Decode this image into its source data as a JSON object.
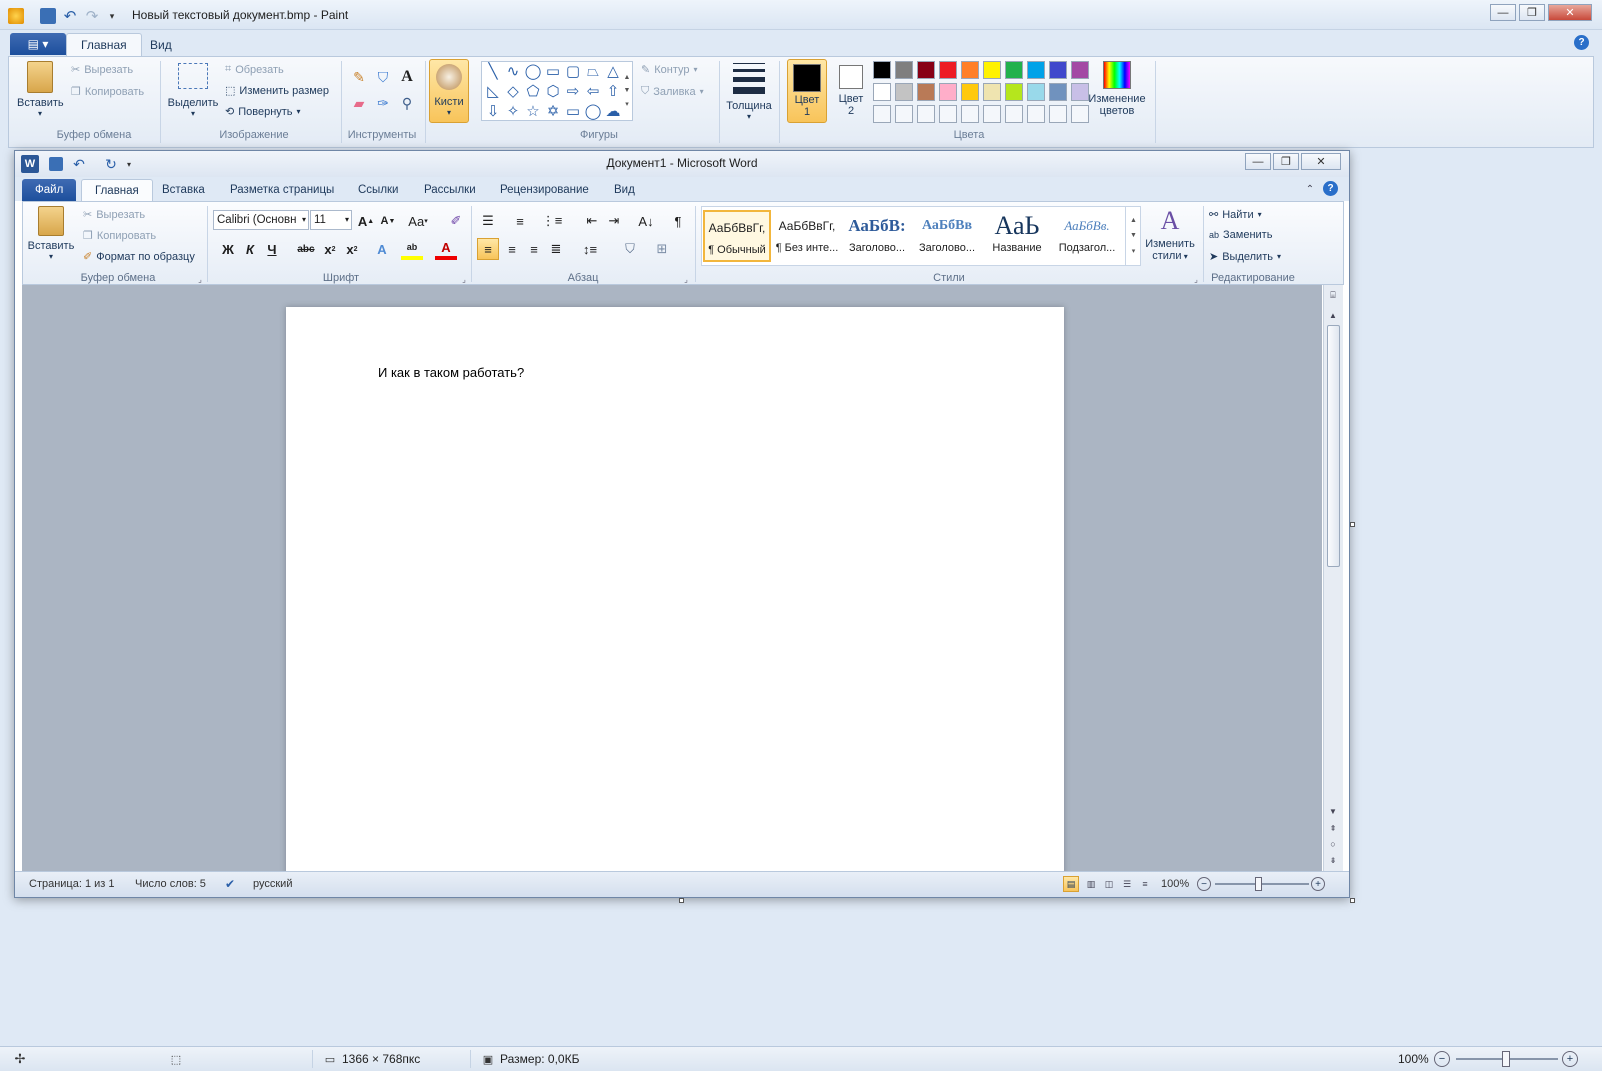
{
  "paint": {
    "title": "Новый текстовый документ.bmp - Paint",
    "tabs": [
      "Главная",
      "Вид"
    ],
    "clipboard": {
      "paste": "Вставить",
      "cut": "Вырезать",
      "copy": "Копировать",
      "group": "Буфер обмена"
    },
    "image": {
      "select": "Выделить",
      "crop": "Обрезать",
      "resize": "Изменить размер",
      "rotate": "Повернуть",
      "group": "Изображение"
    },
    "tools": {
      "group": "Инструменты"
    },
    "brushes": "Кисти",
    "shapes": {
      "outline": "Контур",
      "fill": "Заливка",
      "group": "Фигуры"
    },
    "size": "Толщина",
    "color1": {
      "label": "Цвет",
      "num": "1"
    },
    "color2": {
      "label": "Цвет",
      "num": "2"
    },
    "edit_colors": {
      "line1": "Изменение",
      "line2": "цветов"
    },
    "colors_group": "Цвета",
    "palette_row1": [
      "#000000",
      "#7f7f7f",
      "#880015",
      "#ed1c24",
      "#ff7f27",
      "#fff200",
      "#22b14c",
      "#00a2e8",
      "#3f48cc",
      "#a349a4"
    ],
    "palette_row2": [
      "#ffffff",
      "#c3c3c3",
      "#b97a57",
      "#ffaec9",
      "#ffc90e",
      "#efe4b0",
      "#b5e61d",
      "#99d9ea",
      "#7092be",
      "#c8bfe7"
    ],
    "status": {
      "dimensions": "1366 × 768пкс",
      "size": "Размер: 0,0КБ",
      "zoom": "100%"
    }
  },
  "word": {
    "title": "Документ1  -  Microsoft Word",
    "tabs": [
      "Файл",
      "Главная",
      "Вставка",
      "Разметка страницы",
      "Ссылки",
      "Рассылки",
      "Рецензирование",
      "Вид"
    ],
    "clipboard": {
      "paste": "Вставить",
      "cut": "Вырезать",
      "copy": "Копировать",
      "format_painter": "Формат по образцу",
      "group": "Буфер обмена"
    },
    "font": {
      "name": "Calibri (Основн",
      "size": "11",
      "group": "Шрифт"
    },
    "paragraph_group": "Абзац",
    "styles": [
      {
        "sample": "АаБбВвГг,",
        "name": "¶ Обычный"
      },
      {
        "sample": "АаБбВвГг,",
        "name": "¶ Без инте..."
      },
      {
        "sample": "АаБбВ:",
        "name": "Заголово..."
      },
      {
        "sample": "АаБбВв",
        "name": "Заголово..."
      },
      {
        "sample": "АаЬ",
        "name": "Название"
      },
      {
        "sample": "АаБбВв.",
        "name": "Подзагол..."
      }
    ],
    "change_styles": {
      "line1": "Изменить",
      "line2": "стили"
    },
    "styles_group": "Стили",
    "editing": {
      "find": "Найти",
      "replace": "Заменить",
      "select": "Выделить",
      "group": "Редактирование"
    },
    "document_text": "И как в таком работать?",
    "status": {
      "page": "Страница: 1 из 1",
      "words": "Число слов: 5",
      "language": "русский",
      "zoom": "100%"
    }
  }
}
